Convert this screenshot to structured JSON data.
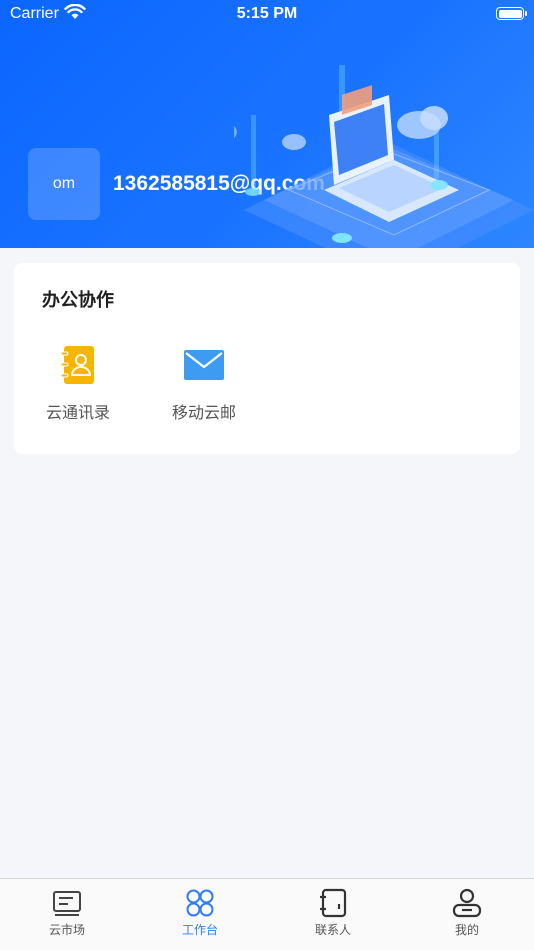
{
  "status_bar": {
    "carrier": "Carrier",
    "time": "5:15 PM"
  },
  "profile": {
    "avatar_text": "om",
    "account": "1362585815@qq.com"
  },
  "office": {
    "title": "办公协作",
    "apps": [
      {
        "label": "云通讯录",
        "icon": "contact-book-icon",
        "color": "#f7b500"
      },
      {
        "label": "移动云邮",
        "icon": "mail-icon",
        "color": "#3d9bf2"
      }
    ]
  },
  "tabbar": {
    "active_color": "#2f7df6",
    "items": [
      {
        "label": "云市场",
        "icon": "market-icon"
      },
      {
        "label": "工作台",
        "icon": "workbench-icon",
        "active": true
      },
      {
        "label": "联系人",
        "icon": "contacts-icon"
      },
      {
        "label": "我的",
        "icon": "profile-icon"
      }
    ]
  }
}
